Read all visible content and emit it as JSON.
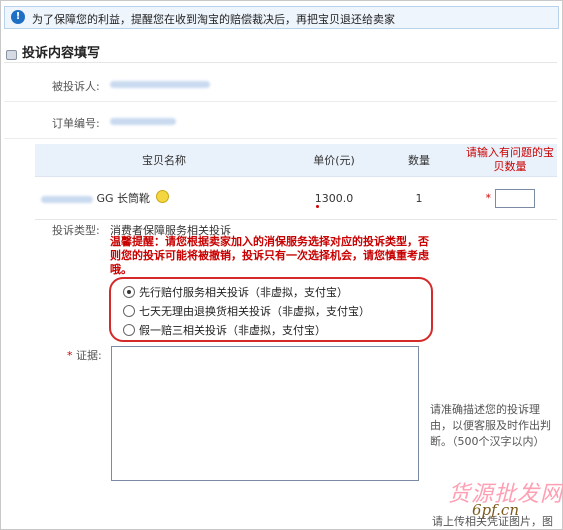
{
  "notice": {
    "icon": "info-icon",
    "text": "为了保障您的利益，提醒您在收到淘宝的赔偿裁决后，再把宝贝退还给卖家"
  },
  "section": {
    "icon": "cup-icon",
    "title": "投诉内容填写"
  },
  "form": {
    "respondent_label": "被投诉人:",
    "order_label": "订单编号:",
    "type_label": "投诉类型:",
    "evidence_label": "证据:",
    "required_mark": "*"
  },
  "table": {
    "headers": [
      "宝贝名称",
      "单价(元)",
      "数量",
      "请输入有问题的宝贝数量"
    ],
    "rows": [
      {
        "name": "GG 长筒靴",
        "price": "1300.0",
        "quantity": "1",
        "problem_qty": ""
      }
    ]
  },
  "complaint": {
    "category": "消费者保障服务相关投诉",
    "warning": "温馨提醒：请您根据卖家加入的消保服务选择对应的投诉类型，否则您的投诉可能将被撤销，投诉只有一次选择机会，请您慎重考虑哦。",
    "options": [
      {
        "label": "先行赔付服务相关投诉（非虚拟，支付宝）",
        "selected": true
      },
      {
        "label": "七天无理由退换货相关投诉（非虚拟，支付宝）",
        "selected": false
      },
      {
        "label": "假一赔三相关投诉（非虚拟，支付宝）",
        "selected": false
      }
    ]
  },
  "evidence": {
    "hint": "请准确描述您的投诉理由，以便客服及时作出判断。（500个汉字以内）",
    "upload_hint": "请上传相关凭证图片，图"
  },
  "watermark": {
    "line1": "货源批发网",
    "line2": "6pf.cn"
  },
  "colors": {
    "accent_blue": "#1f6fc4",
    "warning_red": "#c80000",
    "highlight_border": "#d42a2a",
    "table_header_bg": "#e9f1fb"
  }
}
